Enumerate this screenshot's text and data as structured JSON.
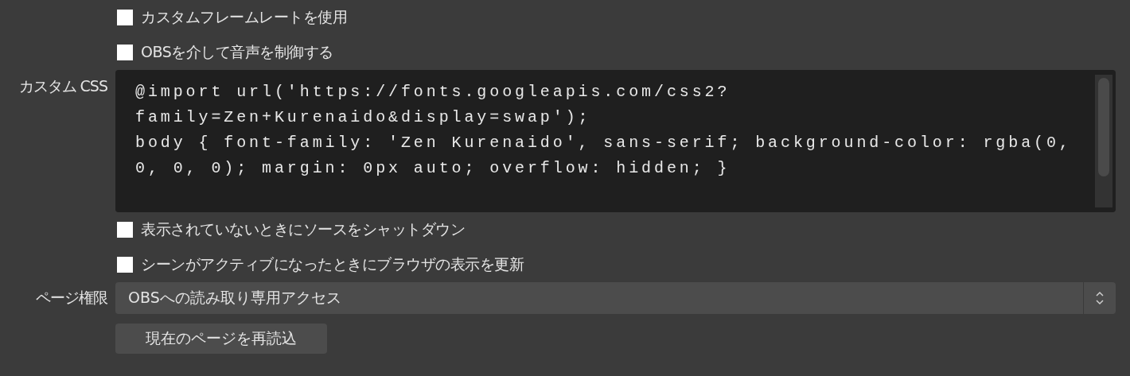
{
  "checkboxes_top": [
    {
      "label": "カスタムフレームレートを使用",
      "checked": false
    },
    {
      "label": "OBSを介して音声を制御する",
      "checked": false
    }
  ],
  "custom_css": {
    "label": "カスタム CSS",
    "lines": [
      "@import url('https://fonts.googleapis.com/css2?",
      "family=Zen+Kurenaido&display=swap');",
      "body { font-family: 'Zen Kurenaido', sans-serif; background-color: rgba(0,",
      "0, 0, 0); margin: 0px auto; overflow: hidden; }"
    ]
  },
  "checkboxes_bottom": [
    {
      "label": "表示されていないときにソースをシャットダウン",
      "checked": false
    },
    {
      "label": "シーンがアクティブになったときにブラウザの表示を更新",
      "checked": false
    }
  ],
  "page_permissions": {
    "label": "ページ権限",
    "value": "OBSへの読み取り専用アクセス"
  },
  "refresh_button": "現在のページを再読込"
}
